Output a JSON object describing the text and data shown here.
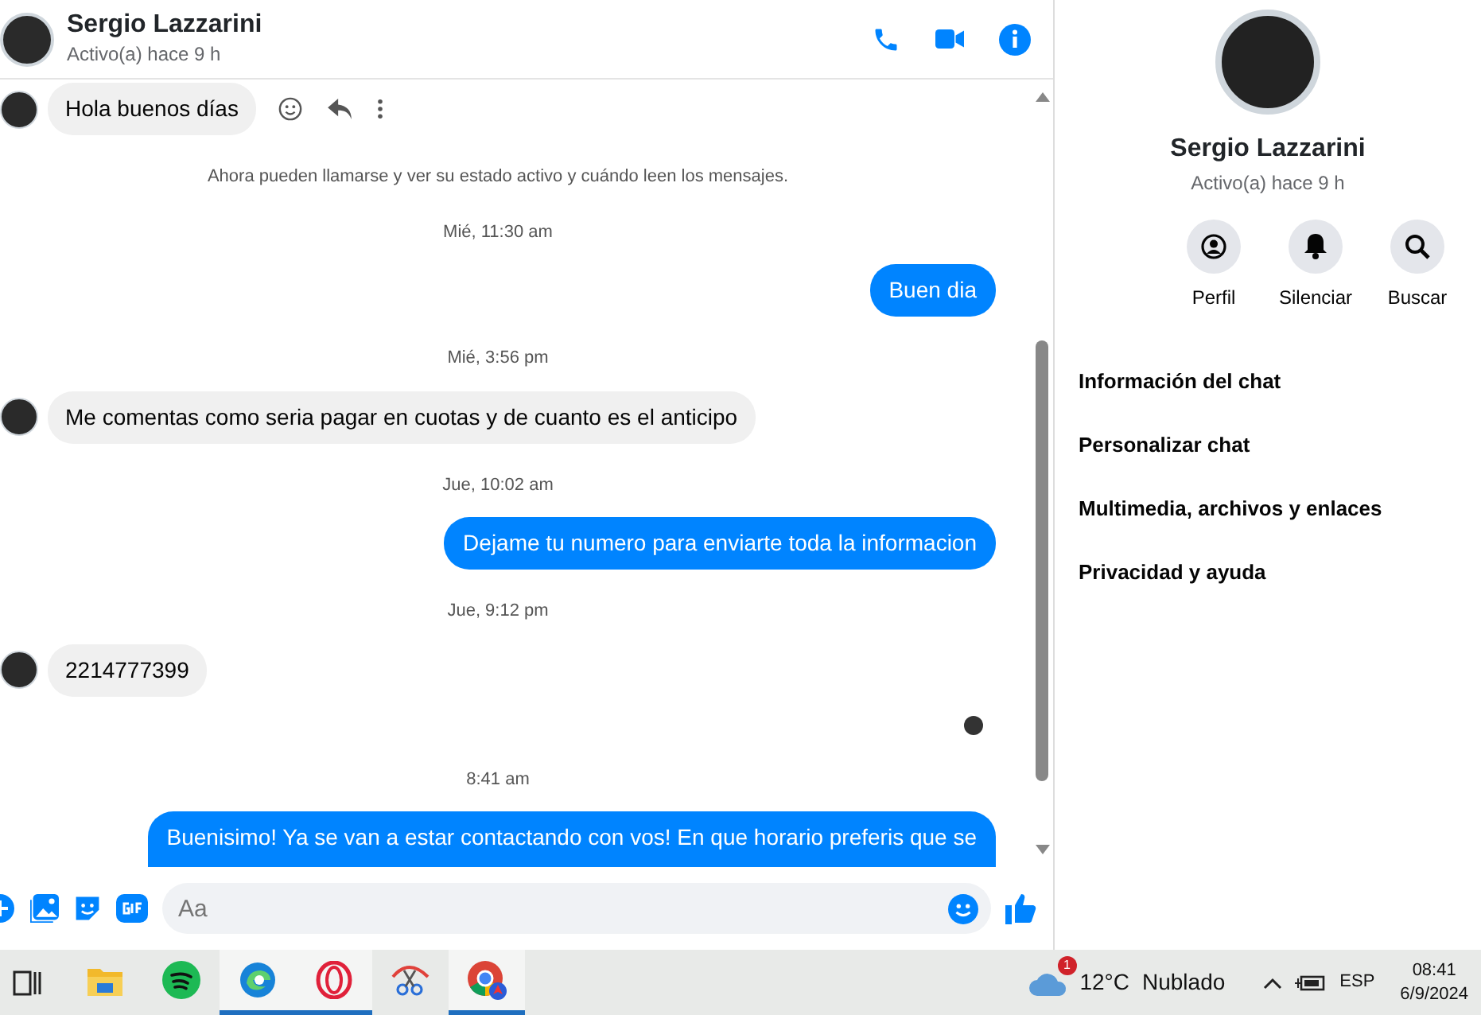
{
  "header": {
    "name": "Sergio Lazzarini",
    "status": "Activo(a) hace 9 h"
  },
  "messages": [
    {
      "kind": "incoming",
      "text": "Hola buenos días",
      "actions": true
    },
    {
      "kind": "notice",
      "text": "Ahora pueden llamarse y ver su estado activo y cuándo leen los mensajes."
    },
    {
      "kind": "time",
      "text": "Mié, 11:30 am"
    },
    {
      "kind": "outgoing",
      "text": "Buen dia"
    },
    {
      "kind": "time",
      "text": "Mié, 3:56 pm"
    },
    {
      "kind": "incoming",
      "text": "Me comentas como seria pagar en cuotas y de cuanto es el anticipo",
      "actions": false
    },
    {
      "kind": "time",
      "text": "Jue, 10:02 am"
    },
    {
      "kind": "outgoing",
      "text": "Dejame tu numero para enviarte toda la informacion"
    },
    {
      "kind": "time",
      "text": "Jue, 9:12 pm"
    },
    {
      "kind": "incoming",
      "text": "2214777399",
      "actions": false
    },
    {
      "kind": "seen"
    },
    {
      "kind": "time",
      "text": "8:41 am"
    },
    {
      "kind": "outgoing",
      "text": "Buenisimo! Ya se van a estar contactando con vos! En que horario preferis que se",
      "cut": true
    }
  ],
  "composer": {
    "placeholder": "Aa"
  },
  "info": {
    "name": "Sergio Lazzarini",
    "status": "Activo(a) hace 9 h",
    "actions": [
      {
        "kind": "profile",
        "label": "Perfil"
      },
      {
        "kind": "mute",
        "label": "Silenciar"
      },
      {
        "kind": "search",
        "label": "Buscar"
      }
    ],
    "sections": [
      "Información del chat",
      "Personalizar chat",
      "Multimedia, archivos y enlaces",
      "Privacidad y ayuda"
    ]
  },
  "taskbar": {
    "apps": [
      {
        "kind": "folder",
        "selected": false
      },
      {
        "kind": "music",
        "selected": false
      },
      {
        "kind": "browser",
        "selected": true
      },
      {
        "kind": "ring",
        "selected": true
      },
      {
        "kind": "scissors",
        "selected": false
      },
      {
        "kind": "chrome",
        "selected": true
      }
    ],
    "weather_badge": "1",
    "temperature": "12°C",
    "condition": "Nublado",
    "language": "ESP",
    "time": "08:41",
    "date": "6/9/2024"
  }
}
